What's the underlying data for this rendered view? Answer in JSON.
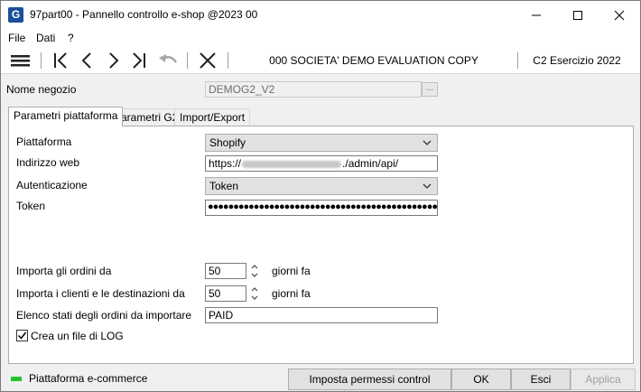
{
  "window": {
    "app_icon_letter": "G",
    "title": "97part00 - Pannello controllo e-shop @2023 00"
  },
  "menu": {
    "file": "File",
    "dati": "Dati",
    "help": "?"
  },
  "toolbar": {
    "icons": [
      "menu-icon",
      "first-record-icon",
      "previous-record-icon",
      "next-record-icon",
      "last-record-icon",
      "undo-icon",
      "close-x-icon"
    ],
    "company": "000 SOCIETA' DEMO EVALUATION COPY",
    "exercise": "C2 Esercizio 2022"
  },
  "form": {
    "store_name_label": "Nome negozio",
    "store_name_value": "DEMOG2_V2",
    "lookup_button": "..."
  },
  "tabs": [
    {
      "label": "Parametri piattaforma",
      "active": true
    },
    {
      "label": "Parametri G2",
      "active": false
    },
    {
      "label": "Import/Export",
      "active": false
    }
  ],
  "platform": {
    "platform_label": "Piattaforma",
    "platform_value": "Shopify",
    "web_label": "Indirizzo web",
    "web_prefix": "https://",
    "web_suffix": "./admin/api/",
    "auth_label": "Autenticazione",
    "auth_value": "Token",
    "token_label": "Token",
    "token_value": "●●●●●●●●●●●●●●●●●●●●●●●●●●●●●●●●●●●●●●●●●●●●●●●●●●●●●●●●●●●●●●",
    "orders_label": "Importa gli ordini da",
    "orders_value": "50",
    "orders_unit": "giorni fa",
    "clients_label": "Importa i clienti e le destinazioni da",
    "clients_value": "50",
    "clients_unit": "giorni fa",
    "states_label": "Elenco stati degli ordini da importare",
    "states_value": "PAID",
    "log_label": "Crea un file di LOG",
    "log_checked": true
  },
  "status": {
    "text": "Piattaforma e-commerce",
    "led_color": "#22c32e"
  },
  "buttons": {
    "permissions": "Imposta permessi control",
    "ok": "OK",
    "esci": "Esci",
    "applica": "Applica"
  }
}
